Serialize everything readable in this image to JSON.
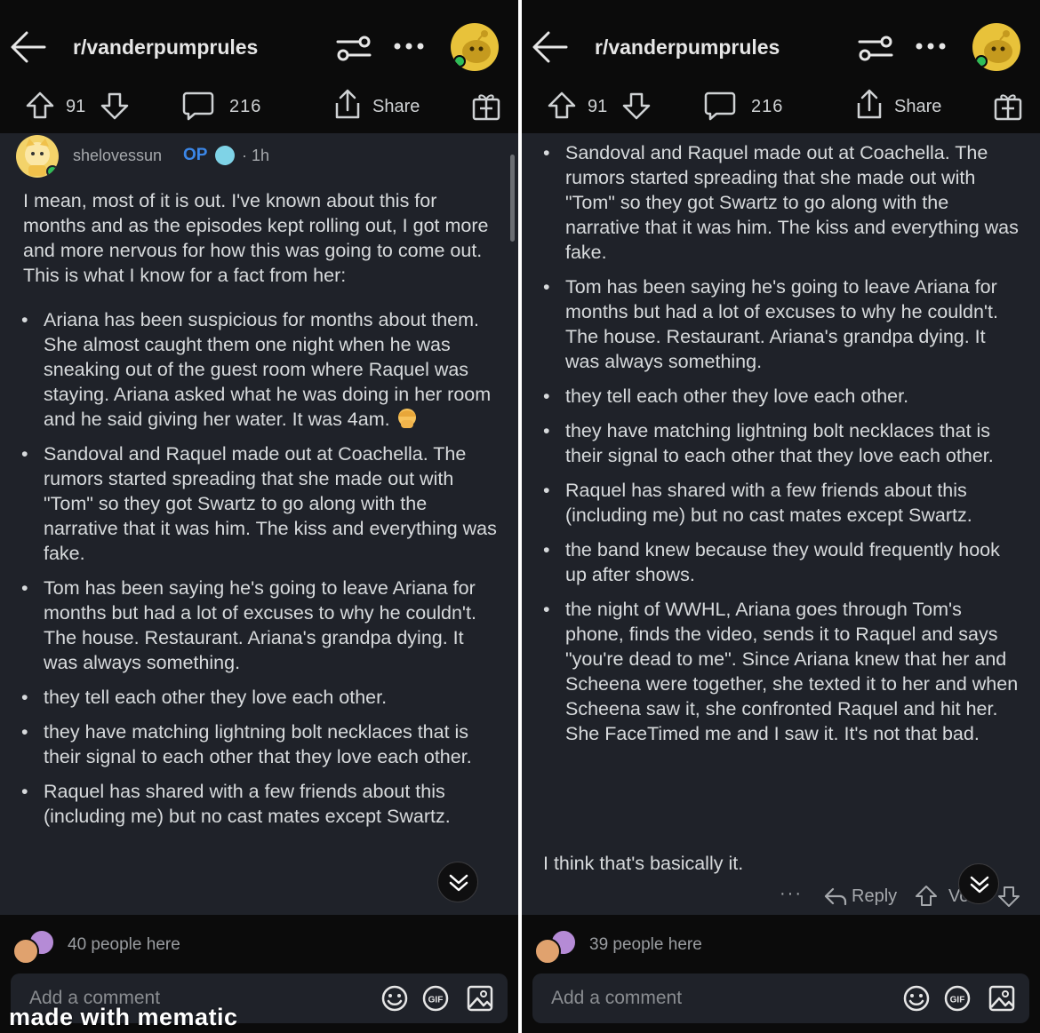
{
  "header": {
    "subreddit": "r/vanderpumprules",
    "upvotes": "91",
    "comments": "216",
    "share_label": "Share"
  },
  "comment": {
    "username": "shelovessun",
    "op_badge": "OP",
    "time": "· 1h",
    "intro": "I mean, most of it is out. I've known about this for months and as the episodes kept rolling out, I got more and more nervous for how this was going to come out. This is what I know for a fact from her:",
    "bullets": [
      "Ariana has been suspicious for months about them. She almost caught them one night when he was sneaking out of the guest room where Raquel was staying. Ariana asked what he was doing in her room and he said giving her water. It was 4am.",
      "Sandoval and Raquel made out at Coachella. The rumors started spreading that she made out with \"Tom\" so they got Swartz to go along with the narrative that it was him. The kiss and everything was fake.",
      "Tom has been saying he's going to leave Ariana for months but had a lot of excuses to why he couldn't. The house. Restaurant. Ariana's grandpa dying. It was always something.",
      "they tell each other they love each other.",
      "they have matching lightning bolt necklaces that is their signal to each other that they love each other.",
      "Raquel has shared with a few friends about this (including me) but no cast mates except Swartz.",
      "the band knew because they would frequently hook up after shows.",
      "the night of WWHL, Ariana goes through Tom's phone, finds the video, sends it to Raquel and says \"you're dead to me\". Since Ariana knew that her and Scheena were together, she texted it to her and when Scheena saw it, she confronted Raquel and hit her. She FaceTimed me and I saw it. It's not that bad."
    ],
    "closing": "I think that's basically it.",
    "footer": {
      "more": "···",
      "reply": "Reply",
      "vote": "Vo"
    }
  },
  "left_panel": {
    "people_here": "40 people here"
  },
  "right_panel": {
    "people_here": "39 people here"
  },
  "composer": {
    "placeholder": "Add a comment",
    "gif_label": "GIF"
  },
  "watermark": "made with mematic",
  "colors": {
    "background": "#1f2229",
    "bar": "#0b0b0b",
    "op_blue": "#3b87e8",
    "online_green": "#2ebd59",
    "avatar_yellow": "#e8c23a"
  }
}
